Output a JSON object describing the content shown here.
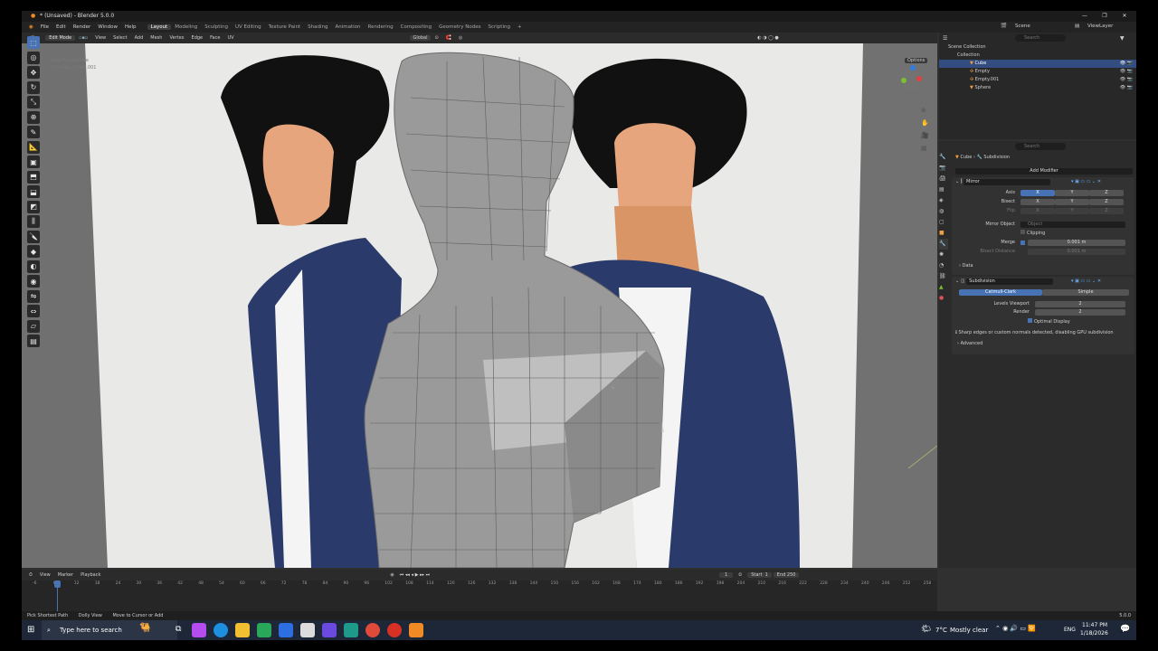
{
  "window": {
    "title": "* (Unsaved) - Blender 5.0.0"
  },
  "menu": {
    "items": [
      "File",
      "Edit",
      "Render",
      "Window",
      "Help"
    ]
  },
  "workspaces": [
    "Layout",
    "Modeling",
    "Sculpting",
    "UV Editing",
    "Texture Paint",
    "Shading",
    "Animation",
    "Rendering",
    "Compositing",
    "Geometry Nodes",
    "Scripting"
  ],
  "active_workspace": "Layout",
  "top_right": {
    "scene": "Scene",
    "viewlayer": "ViewLayer"
  },
  "viewport_header": {
    "mode": "Edit Mode",
    "menus": [
      "View",
      "Select",
      "Add",
      "Mesh",
      "Vertex",
      "Edge",
      "Face",
      "UV"
    ],
    "orientation": "Global",
    "options": "Options",
    "axes": [
      "X",
      "Y",
      "Z"
    ]
  },
  "viewport_overlay": {
    "view_name": "User Perspective",
    "object_info": "(1) Cube | Cube.001"
  },
  "outliner": {
    "search_placeholder": "Search",
    "root": "Scene Collection",
    "collection": "Collection",
    "items": [
      {
        "name": "Cube",
        "selected": true
      },
      {
        "name": "Empty",
        "selected": false
      },
      {
        "name": "Empty.001",
        "selected": false
      },
      {
        "name": "Sphere",
        "selected": false
      }
    ]
  },
  "properties": {
    "search_placeholder": "Search",
    "breadcrumb": [
      "Cube",
      "Subdivision"
    ],
    "add_modifier": "Add Modifier",
    "mirror": {
      "name": "Mirror",
      "axis_label": "Axis",
      "bisect_label": "Bisect",
      "flip_label": "Flip",
      "axes": [
        "X",
        "Y",
        "Z"
      ],
      "mirror_object_label": "Mirror Object",
      "mirror_object_placeholder": "Object",
      "clipping_label": "Clipping",
      "merge_label": "Merge",
      "merge_value": "0.001 m",
      "bisect_distance_label": "Bisect Distance",
      "bisect_distance_value": "0.001 m",
      "data_label": "Data"
    },
    "subdivision": {
      "name": "Subdivision",
      "method_a": "Catmull-Clark",
      "method_b": "Simple",
      "levels_viewport_label": "Levels Viewport",
      "levels_viewport": "2",
      "render_label": "Render",
      "render_value": "2",
      "optimal_display_label": "Optimal Display",
      "warning": "Sharp edges or custom normals detected, disabling GPU subdivision",
      "advanced_label": "Advanced"
    }
  },
  "timeline": {
    "menus": [
      "View",
      "Marker",
      "Playback"
    ],
    "current_frame": "1",
    "start_label": "Start",
    "start": "1",
    "end_label": "End",
    "end": "250",
    "ticks": [
      "-6",
      "6",
      "12",
      "18",
      "24",
      "30",
      "36",
      "42",
      "48",
      "54",
      "60",
      "66",
      "72",
      "78",
      "84",
      "90",
      "96",
      "102",
      "108",
      "114",
      "120",
      "126",
      "132",
      "138",
      "144",
      "150",
      "156",
      "162",
      "168",
      "174",
      "180",
      "186",
      "192",
      "198",
      "204",
      "210",
      "216",
      "222",
      "228",
      "234",
      "240",
      "246",
      "252",
      "258"
    ],
    "playhead_label": "0"
  },
  "statusbar": {
    "items": [
      "Pick Shortest Path",
      "Dolly View",
      "Move to Cursor or Add"
    ],
    "version": "5.0.0"
  },
  "taskbar": {
    "search_placeholder": "Type here to search",
    "weather_temp": "7°C",
    "weather_text": "Mostly clear",
    "lang": "ENG",
    "time": "11:47 PM",
    "date": "1/18/2026"
  }
}
